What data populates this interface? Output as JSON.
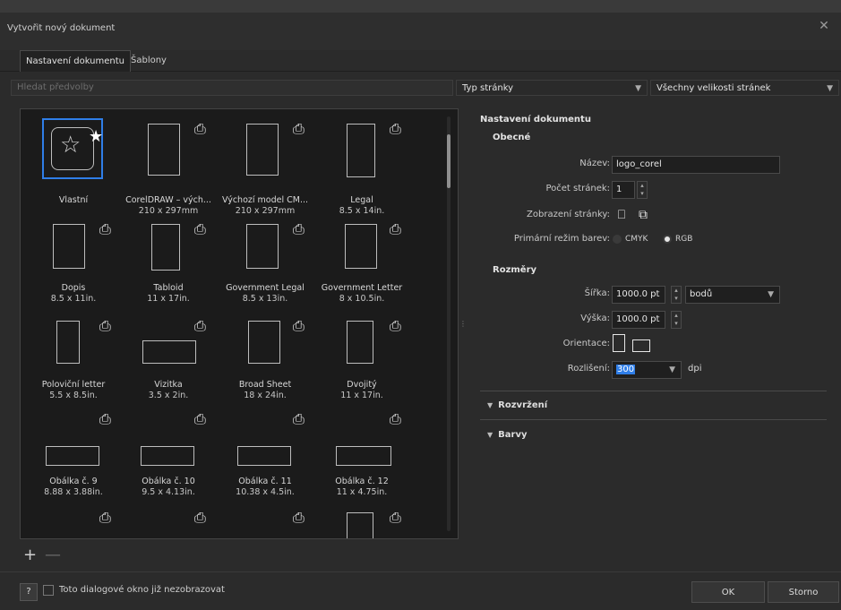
{
  "window": {
    "title": "Vytvořit nový dokument"
  },
  "tabs": [
    {
      "label": "Nastavení dokumentu",
      "active": true
    },
    {
      "label": "Šablony",
      "active": false
    }
  ],
  "search": {
    "placeholder": "Hledat předvolby"
  },
  "filters": {
    "page_type": "Typ stránky",
    "sizes": "Všechny velikosti stránek"
  },
  "presets": [
    {
      "name": "Vlastní",
      "size": ""
    },
    {
      "name": "CorelDRAW – vých...",
      "size": "210 x 297mm"
    },
    {
      "name": "Výchozí model CM...",
      "size": "210 x 297mm"
    },
    {
      "name": "Legal",
      "size": "8.5 x 14in."
    },
    {
      "name": "Dopis",
      "size": "8.5 x 11in."
    },
    {
      "name": "Tabloid",
      "size": "11 x 17in."
    },
    {
      "name": "Government Legal",
      "size": "8.5 x 13in."
    },
    {
      "name": "Government Letter",
      "size": "8 x 10.5in."
    },
    {
      "name": "Poloviční letter",
      "size": "5.5 x 8.5in."
    },
    {
      "name": "Vizitka",
      "size": "3.5 x 2in."
    },
    {
      "name": "Broad Sheet",
      "size": "18 x 24in."
    },
    {
      "name": "Dvojitý",
      "size": "11 x 17in."
    },
    {
      "name": "Obálka č. 9",
      "size": "8.88 x 3.88in."
    },
    {
      "name": "Obálka č. 10",
      "size": "9.5 x 4.13in."
    },
    {
      "name": "Obálka č. 11",
      "size": "10.38 x 4.5in."
    },
    {
      "name": "Obálka č. 12",
      "size": "11 x 4.75in."
    }
  ],
  "settings": {
    "heading": "Nastavení dokumentu",
    "general": {
      "heading": "Obecné",
      "name_label": "Název:",
      "name_value": "logo_corel",
      "pages_label": "Počet stránek:",
      "pages_value": "1",
      "view_label": "Zobrazení stránky:",
      "color_mode_label": "Primární režim barev:",
      "color_modes": [
        {
          "label": "CMYK",
          "selected": false
        },
        {
          "label": "RGB",
          "selected": true
        }
      ]
    },
    "dimensions": {
      "heading": "Rozměry",
      "width_label": "Šířka:",
      "width_value": "1000.0 pt",
      "units_value": "bodů",
      "height_label": "Výška:",
      "height_value": "1000.0 pt",
      "orientation_label": "Orientace:",
      "resolution_label": "Rozlišení:",
      "resolution_value": "300",
      "resolution_unit": "dpi"
    },
    "sections": [
      "Rozvržení",
      "Barvy"
    ]
  },
  "footer": {
    "help_label": "?",
    "dont_show_label": "Toto dialogové okno již nezobrazovat",
    "ok_label": "OK",
    "cancel_label": "Storno"
  },
  "colors": {
    "accent": "#2f7ee8",
    "background": "#2b2b2b",
    "panel": "#1b1b1b"
  }
}
